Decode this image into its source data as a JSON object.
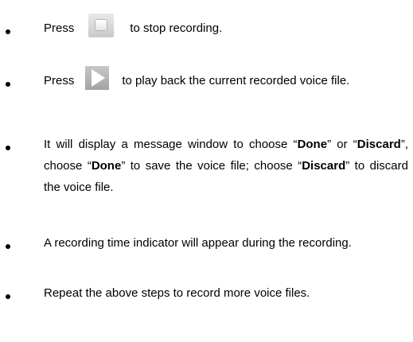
{
  "items": [
    {
      "before": "Press",
      "icon": "stop-button-icon",
      "after": "to stop recording."
    },
    {
      "before": "Press",
      "icon": "play-button-icon",
      "after": "to play back the current recorded voice file."
    },
    {
      "part1": "It will display a message window to choose “",
      "done": "Done",
      "part2": "” or “",
      "discard": "Discard",
      "part3": "”, choose “",
      "done2": "Done",
      "part4": "” to save the voice file; choose “",
      "discard2": "Discard",
      "part5": "” to discard the voice file."
    },
    {
      "text": "A recording time indicator will appear during the recording."
    },
    {
      "text": "Repeat the above steps to record more voice files."
    }
  ]
}
